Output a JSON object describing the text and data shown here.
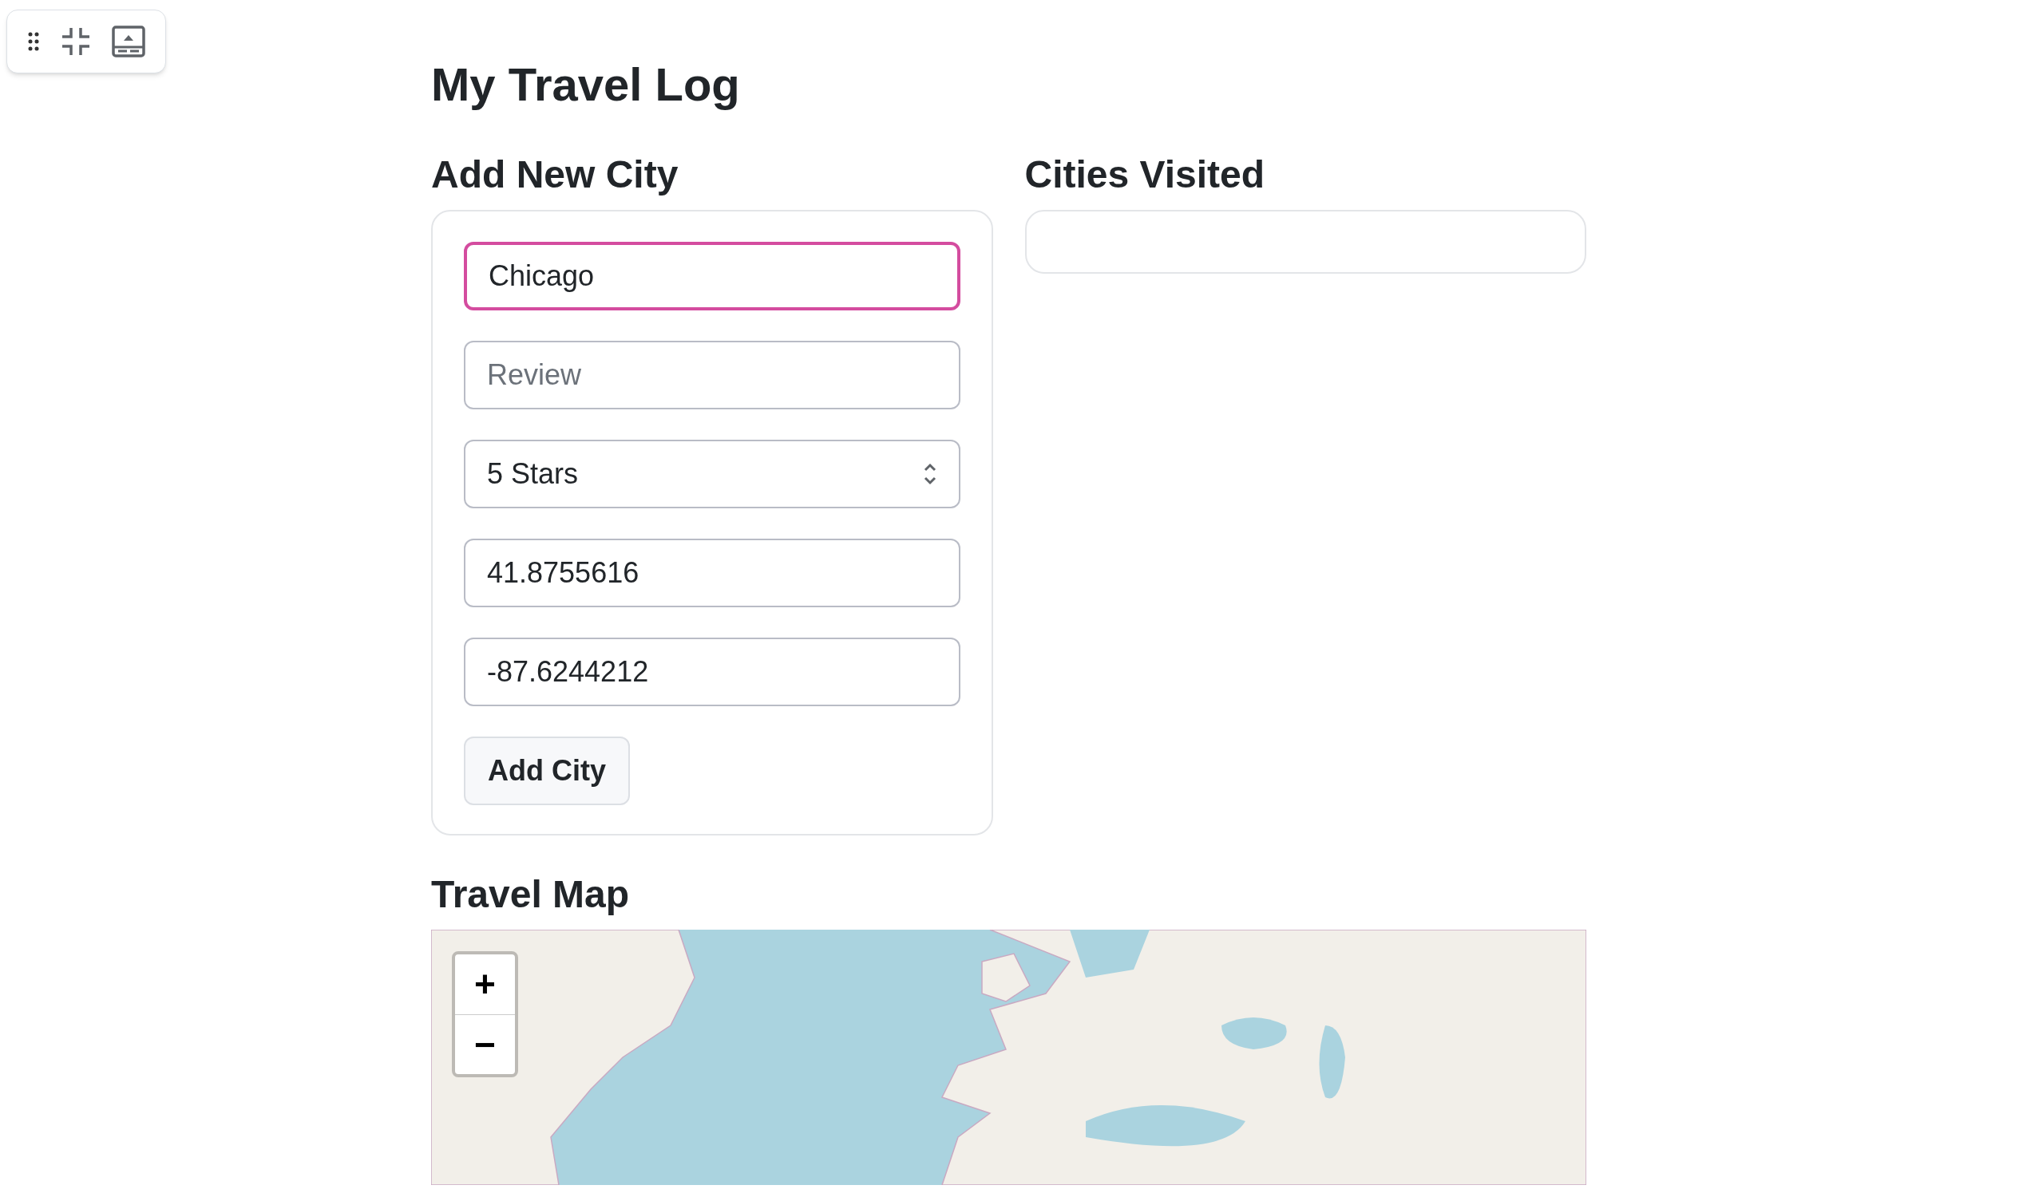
{
  "page_title": "My Travel Log",
  "add_city": {
    "heading": "Add New City",
    "fields": [
      {
        "kind": "text",
        "value": "Chicago",
        "focused": true
      },
      {
        "kind": "text",
        "placeholder": "Review",
        "focused": false
      },
      {
        "kind": "select",
        "value": "5 Stars",
        "focused": false
      },
      {
        "kind": "text",
        "value": "41.8755616",
        "focused": false
      },
      {
        "kind": "text",
        "value": "-87.6244212",
        "focused": false
      }
    ],
    "button": "Add City"
  },
  "cities_visited": {
    "heading": "Cities Visited"
  },
  "travel_map": {
    "heading": "Travel Map",
    "zoom_buttons": [
      "+",
      "−"
    ]
  }
}
